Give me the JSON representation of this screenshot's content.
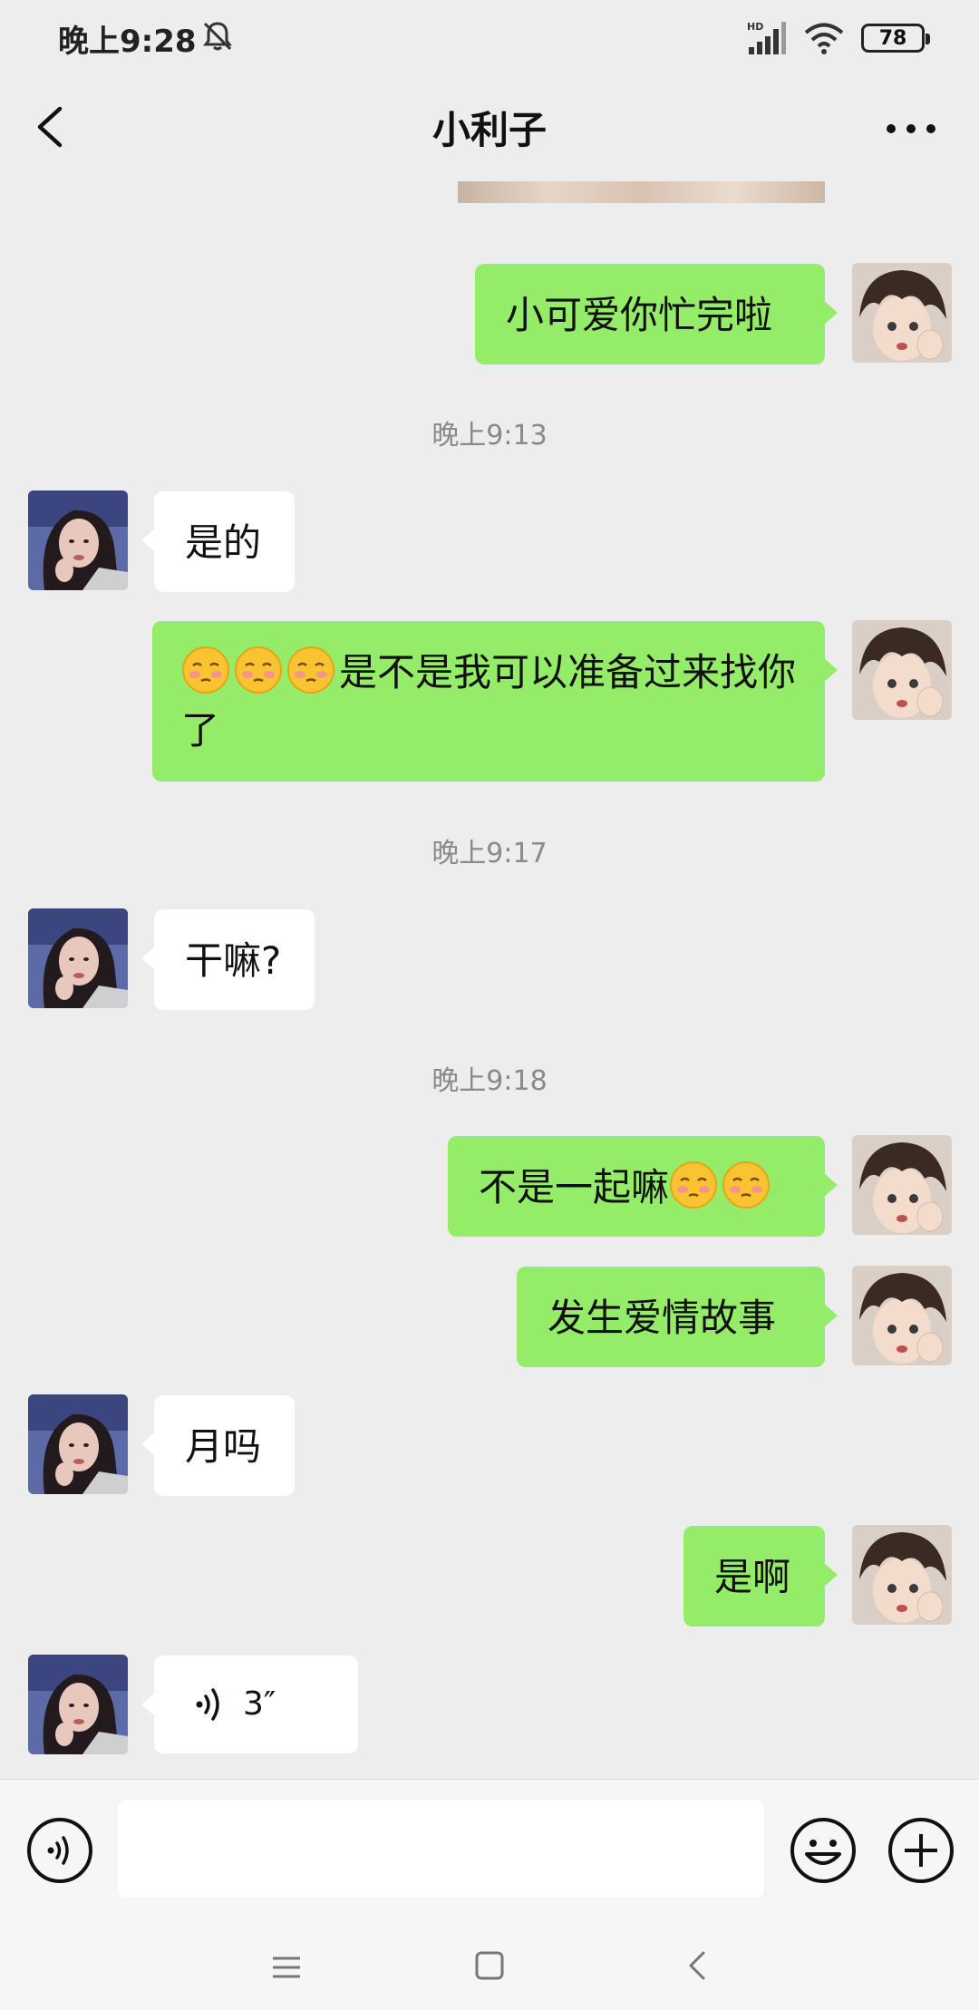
{
  "status_bar": {
    "time": "晚上9:28",
    "battery": "78",
    "network_label": "HD"
  },
  "header": {
    "title": "小利子"
  },
  "messages": {
    "m1": {
      "text": "小可爱你忙完啦"
    },
    "t1": {
      "text": "晚上9:13"
    },
    "m2": {
      "text": "是的"
    },
    "m3": {
      "text": "是不是我可以准备过来找你了",
      "emoji_count": 3
    },
    "t2": {
      "text": "晚上9:17"
    },
    "m4": {
      "text": "干嘛?"
    },
    "t3": {
      "text": "晚上9:18"
    },
    "m5": {
      "text": "不是一起嘛",
      "emoji_count": 2
    },
    "m6": {
      "text": "发生爱情故事"
    },
    "m7": {
      "text": "月吗"
    },
    "m8": {
      "text": "是啊"
    },
    "m9": {
      "duration": "3″",
      "type": "voice"
    }
  },
  "input": {
    "value": "",
    "placeholder": ""
  },
  "colors": {
    "my_bubble": "#95ec69",
    "their_bubble": "#ffffff",
    "background": "#ededed"
  },
  "icons": [
    "back-icon",
    "more-icon",
    "voice-toggle-icon",
    "emoji-icon",
    "plus-icon",
    "nav-menu-icon",
    "nav-home-icon",
    "nav-back-icon"
  ]
}
